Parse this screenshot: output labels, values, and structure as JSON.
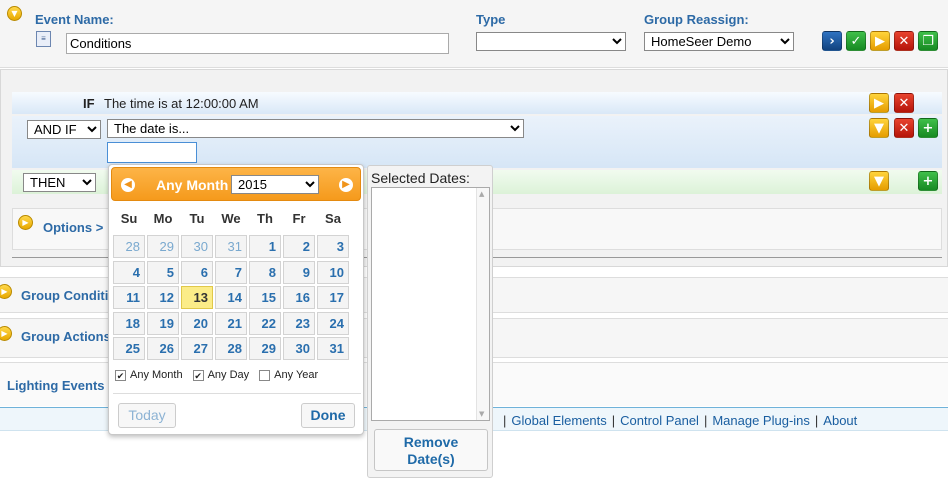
{
  "event": {
    "name_label": "Event Name:",
    "name_value": "Conditions",
    "type_label": "Type",
    "type_value": "",
    "group_label": "Group Reassign:",
    "group_value": "HomeSeer Demo"
  },
  "condition": {
    "if_label": "IF",
    "if_text": "The time is at 12:00:00 AM",
    "and_if_value": "AND IF",
    "date_select_value": "The date is...",
    "then_value": "THEN"
  },
  "options_label": "Options >",
  "sections": [
    {
      "label": "Group Conditions"
    },
    {
      "label": "Group Actions"
    },
    {
      "label": "Lighting Events"
    }
  ],
  "footer_links": [
    "Global Elements",
    "Control Panel",
    "Manage Plug-ins",
    "About"
  ],
  "datepicker": {
    "month_label": "Any Month",
    "year_value": "2015",
    "weekdays": [
      "Su",
      "Mo",
      "Tu",
      "We",
      "Th",
      "Fr",
      "Sa"
    ],
    "weeks": [
      [
        "28",
        "29",
        "30",
        "31",
        "1",
        "2",
        "3"
      ],
      [
        "4",
        "5",
        "6",
        "7",
        "8",
        "9",
        "10"
      ],
      [
        "11",
        "12",
        "13",
        "14",
        "15",
        "16",
        "17"
      ],
      [
        "18",
        "19",
        "20",
        "21",
        "22",
        "23",
        "24"
      ],
      [
        "25",
        "26",
        "27",
        "28",
        "29",
        "30",
        "31"
      ]
    ],
    "today": "13",
    "checkboxes": [
      {
        "label": "Any Month",
        "checked": true
      },
      {
        "label": "Any Day",
        "checked": true
      },
      {
        "label": "Any Year",
        "checked": false
      }
    ],
    "today_button": "Today",
    "done_button": "Done"
  },
  "selected_dates": {
    "title": "Selected Dates:",
    "remove_button": "Remove Date(s)"
  }
}
